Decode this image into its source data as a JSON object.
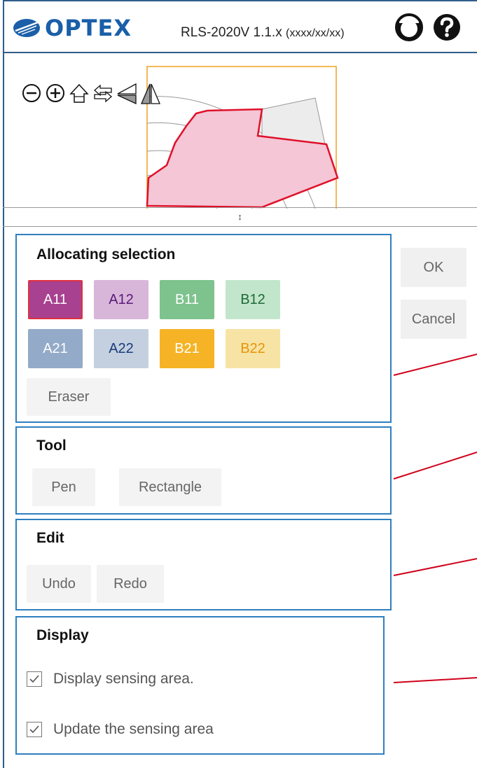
{
  "header": {
    "brand": "OPTEX",
    "title_main": "RLS-2020V 1.1.x ",
    "title_small": "(xxxx/xx/xx)",
    "icons": [
      "account-icon",
      "help-icon"
    ]
  },
  "map_toolbar": {
    "icons": [
      "zoom-out-icon",
      "zoom-in-icon",
      "home-icon",
      "swap-arrows-icon",
      "flip-horizontal-icon",
      "flip-vertical-icon"
    ]
  },
  "splitter": {
    "glyph": "↕"
  },
  "allocating": {
    "title": "Allocating selection",
    "buttons": [
      {
        "label": "A11",
        "bg": "#a8418f",
        "fg": "#ffffff",
        "border": "#e03040"
      },
      {
        "label": "A12",
        "bg": "#d8b6d9",
        "fg": "#5a1a7a",
        "border": ""
      },
      {
        "label": "B11",
        "bg": "#7ec28d",
        "fg": "#ffffff",
        "border": ""
      },
      {
        "label": "B12",
        "bg": "#c2e6cb",
        "fg": "#1e6a38",
        "border": ""
      },
      {
        "label": "A21",
        "bg": "#93aac8",
        "fg": "#ffffff",
        "border": ""
      },
      {
        "label": "A22",
        "bg": "#c4d0e0",
        "fg": "#1a3a7a",
        "border": ""
      },
      {
        "label": "B21",
        "bg": "#f5b325",
        "fg": "#ffffff",
        "border": ""
      },
      {
        "label": "B22",
        "bg": "#f7e3a3",
        "fg": "#e6950a",
        "border": ""
      }
    ],
    "eraser": "Eraser"
  },
  "tool": {
    "title": "Tool",
    "pen": "Pen",
    "rectangle": "Rectangle"
  },
  "edit": {
    "title": "Edit",
    "undo": "Undo",
    "redo": "Redo"
  },
  "display": {
    "title": "Display",
    "options": [
      {
        "label": "Display sensing area.",
        "checked": true
      },
      {
        "label": "Update the sensing area",
        "checked": true
      }
    ]
  },
  "actions": {
    "ok": "OK",
    "cancel": "Cancel"
  },
  "colors": {
    "accent_blue": "#2f7fbf",
    "leader_red": "#d0021b",
    "zone_fill": "#f4c6d6",
    "zone_stroke": "#e0102a",
    "frame_orange": "#f0a020"
  }
}
